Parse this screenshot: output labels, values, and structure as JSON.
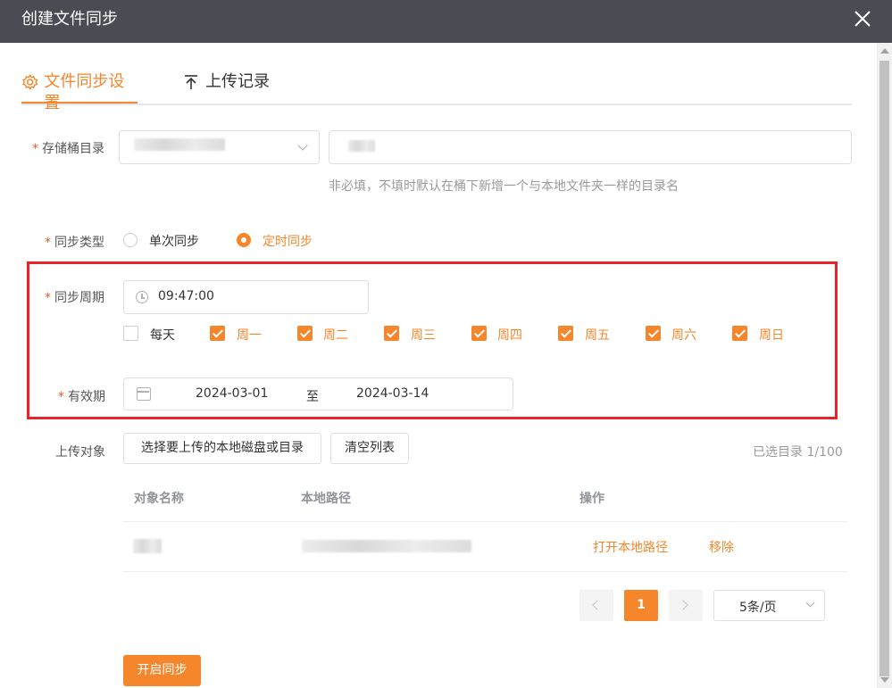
{
  "dialog": {
    "title": "创建文件同步"
  },
  "tabs": [
    {
      "label": "文件同步设置",
      "icon": "gear-icon",
      "active": true
    },
    {
      "label": "上传记录",
      "icon": "upload-icon",
      "active": false
    }
  ],
  "bucket_dir": {
    "label": "存储桶目录",
    "hint": "非必填，不填时默认在桶下新增一个与本地文件夹一样的目录名"
  },
  "sync_type": {
    "label": "同步类型",
    "options": [
      {
        "label": "单次同步",
        "checked": false
      },
      {
        "label": "定时同步",
        "checked": true
      }
    ]
  },
  "sync_period": {
    "label": "同步周期",
    "time": "09:47:00",
    "days": [
      {
        "label": "每天",
        "checked": false
      },
      {
        "label": "周一",
        "checked": true
      },
      {
        "label": "周二",
        "checked": true
      },
      {
        "label": "周三",
        "checked": true
      },
      {
        "label": "周四",
        "checked": true
      },
      {
        "label": "周五",
        "checked": true
      },
      {
        "label": "周六",
        "checked": true
      },
      {
        "label": "周日",
        "checked": true
      }
    ]
  },
  "validity": {
    "label": "有效期",
    "start": "2024-03-01",
    "separator": "至",
    "end": "2024-03-14"
  },
  "upload_target": {
    "label": "上传对象",
    "select_button": "选择要上传的本地磁盘或目录",
    "clear_button": "清空列表",
    "selected_count": "已选目录 1/100"
  },
  "table": {
    "columns": [
      "对象名称",
      "本地路径",
      "操作"
    ],
    "row_actions": [
      "打开本地路径",
      "移除"
    ]
  },
  "pagination": {
    "current_page": "1",
    "page_size": "5条/页"
  },
  "footer": {
    "start_button": "开启同步"
  },
  "colors": {
    "accent": "#f5862b",
    "titlebar": "#4a4b53",
    "highlight_border": "#e8232a"
  }
}
